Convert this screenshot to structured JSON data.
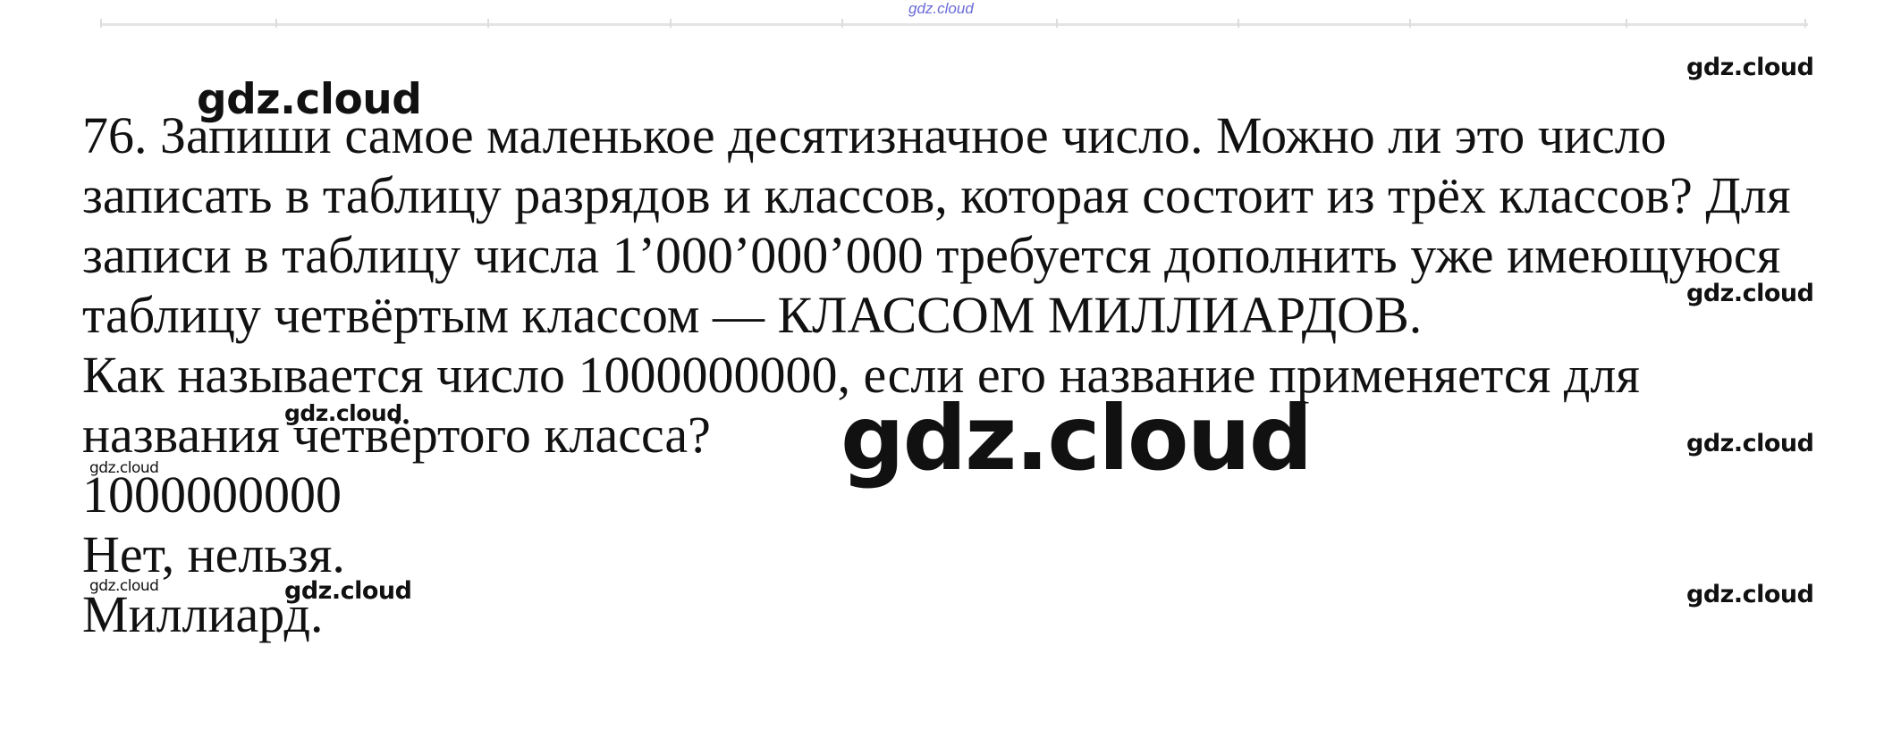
{
  "watermarks": {
    "text": "gdz.cloud",
    "top_small": "gdz.cloud"
  },
  "problem": {
    "lines": [
      "76. Запиши самое маленькое десятизначное число. Можно ли это число",
      "записать в таблицу разрядов и классов, которая состоит из трёх классов? Для",
      "записи в таблицу числа 1’000’000’000 требуется дополнить уже имеющуюся",
      "таблицу четвёртым классом — КЛАССОМ МИЛЛИАРДОВ.",
      "Как называется число 1000000000, если его название применяется для",
      "названия четвёртого класса?"
    ]
  },
  "answers": {
    "number": "1000000000",
    "can_write": "Нет, нельзя.",
    "name": "Миллиард."
  }
}
